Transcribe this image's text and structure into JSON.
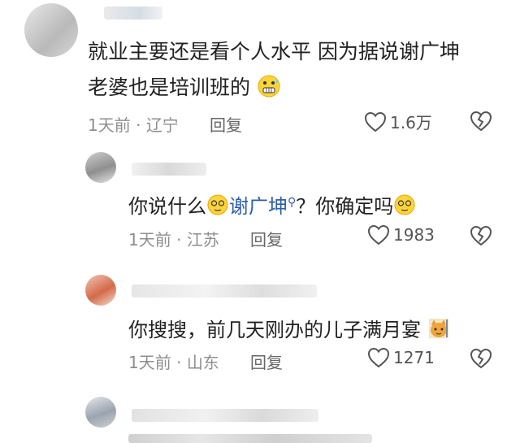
{
  "comments": [
    {
      "text_line1": "就业主要还是看个人水平 因为据说谢广坤",
      "text_line2": "老婆也是培训班的",
      "time": "1天前",
      "location": "辽宁",
      "reply_label": "回复",
      "likes": "1.6万"
    },
    {
      "text_before": "你说什么",
      "mention": "谢广坤",
      "text_after": "？你确定吗",
      "time": "1天前",
      "location": "江苏",
      "reply_label": "回复",
      "likes": "1983"
    },
    {
      "text": "你搜搜，前几天刚办的儿子满月宴",
      "time": "1天前",
      "location": "山东",
      "reply_label": "回复",
      "likes": "1271"
    }
  ],
  "meta_separator": "·",
  "icons": [
    "heart-outline-icon",
    "broken-heart-icon",
    "grimace-emoji",
    "dizzy-emoji",
    "cat-emoji",
    "search-icon"
  ]
}
